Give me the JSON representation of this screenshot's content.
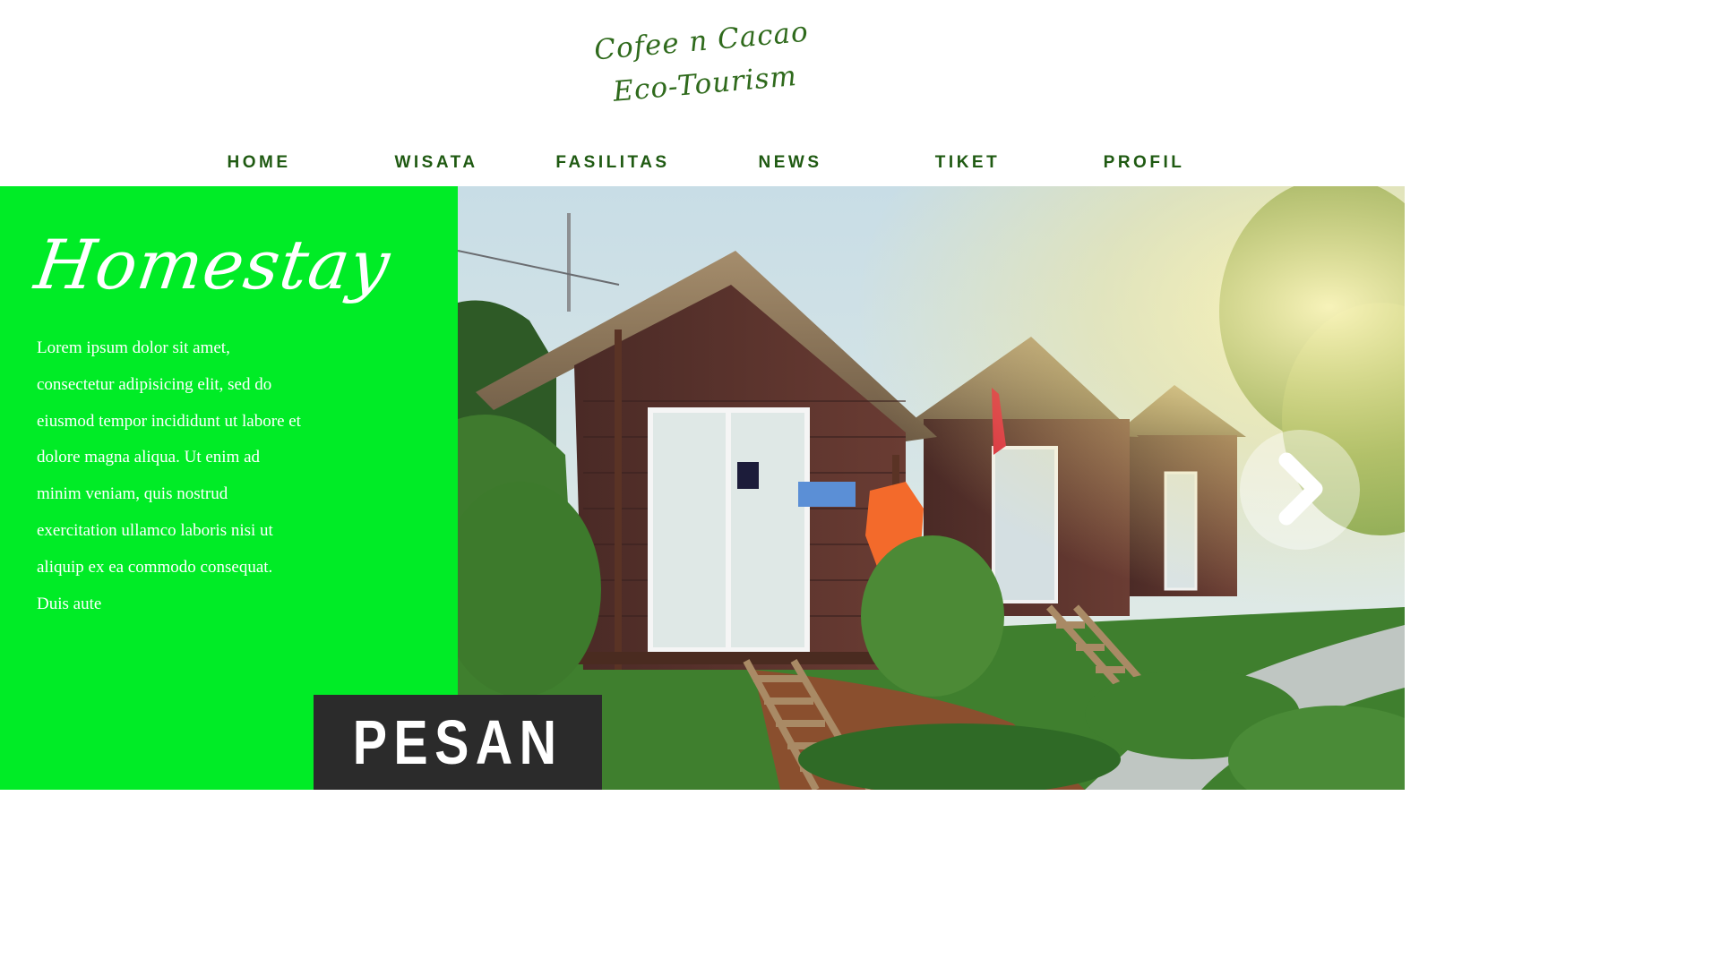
{
  "header": {
    "logo_line1": "Cofee n Cacao",
    "logo_line2": "Eco-Tourism",
    "brand_color": "#2f6a1c"
  },
  "nav": {
    "items": [
      {
        "label": "HOME"
      },
      {
        "label": "WISATA"
      },
      {
        "label": "FASILITAS"
      },
      {
        "label": "NEWS"
      },
      {
        "label": "TIKET"
      },
      {
        "label": "PROFIL"
      }
    ],
    "color": "#1f5a12"
  },
  "hero": {
    "title": "Homestay",
    "description": "Lorem ipsum dolor sit amet, consectetur adipisicing elit, sed do eiusmod tempor incididunt ut labore et dolore magna aliqua. Ut enim ad minim veniam, quis nostrud exercitation ullamco laboris nisi ut aliquip ex ea commodo consequat. Duis aute",
    "panel_color": "#00ec26",
    "image": "wooden homestay cabins with thatched roofs and steps",
    "next_icon": "chevron-right-icon",
    "cta_label": "PESAN",
    "cta_color": "#2b2b2b"
  }
}
